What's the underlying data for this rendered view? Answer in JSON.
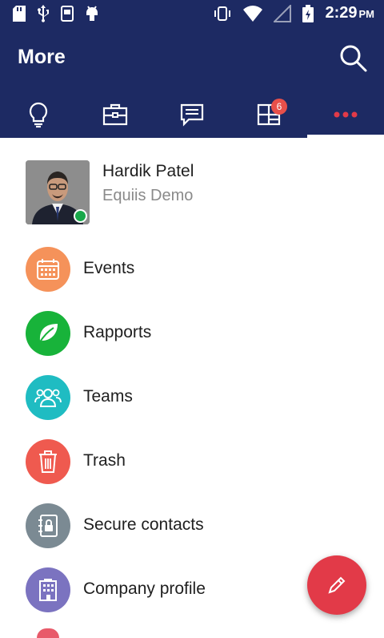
{
  "status_bar": {
    "time": "2:29",
    "ampm": "PM"
  },
  "app_bar": {
    "title": "More"
  },
  "tabs": [
    {
      "icon": "lightbulb-icon"
    },
    {
      "icon": "briefcase-icon"
    },
    {
      "icon": "chat-icon"
    },
    {
      "icon": "grid-icon",
      "badge": "6"
    },
    {
      "icon": "more-dots-icon",
      "active": true
    }
  ],
  "profile": {
    "name": "Hardik Patel",
    "subtitle": "Equiis Demo",
    "status": "online"
  },
  "menu": [
    {
      "label": "Events",
      "icon": "calendar-icon",
      "color": "#f5925a"
    },
    {
      "label": "Rapports",
      "icon": "leaf-icon",
      "color": "#18b33a"
    },
    {
      "label": "Teams",
      "icon": "people-icon",
      "color": "#1fbcc2"
    },
    {
      "label": "Trash",
      "icon": "trash-icon",
      "color": "#ef5a4f"
    },
    {
      "label": "Secure contacts",
      "icon": "locked-contacts-icon",
      "color": "#7b8a93"
    },
    {
      "label": "Company profile",
      "icon": "building-icon",
      "color": "#7b73c0"
    }
  ],
  "colors": {
    "header": "#1d2a63",
    "accent": "#e23a48"
  }
}
